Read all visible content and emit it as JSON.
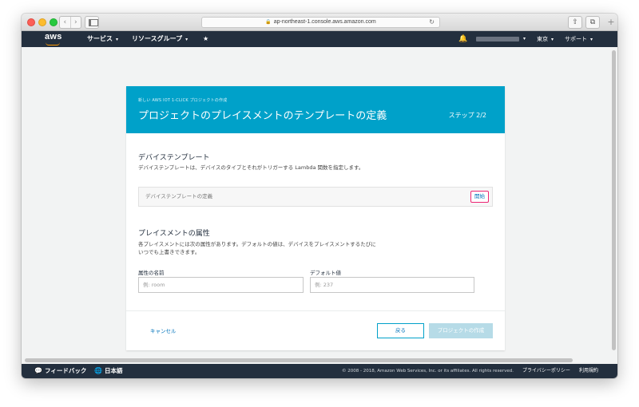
{
  "browser": {
    "address": "ap-northeast-1.console.aws.amazon.com",
    "lock_icon": "🔒",
    "reload_icon": "↻",
    "back_icon": "‹",
    "forward_icon": "›",
    "share_icon": "⇧",
    "tabs_icon": "⧉",
    "newtab_icon": "+"
  },
  "aws_nav": {
    "logo": "aws",
    "services": "サービス",
    "resource_groups": "リソースグループ",
    "caret": "▾",
    "pin_icon": "★",
    "bell_icon": "🔔",
    "region": "東京",
    "support": "サポート"
  },
  "header": {
    "breadcrumb": "新しい AWS IOT 1-CLICK プロジェクトの作成",
    "title": "プロジェクトのプレイスメントのテンプレートの定義",
    "step": "ステップ 2/2"
  },
  "device_template": {
    "title": "デバイステンプレート",
    "description": "デバイステンプレートは、デバイスのタイプとそれがトリガーする Lambda 関数を指定します。",
    "box_label": "デバイステンプレートの定義",
    "start_button": "開始"
  },
  "placement": {
    "title": "プレイスメントの属性",
    "description": "各プレイスメントには次の属性があります。デフォルトの値は、デバイスをプレイスメントするたびにいつでも上書きできます。",
    "attr_name_label": "属性の名前",
    "attr_name_placeholder": "例: room",
    "default_value_label": "デフォルト値",
    "default_value_placeholder": "例: 237"
  },
  "actions": {
    "cancel": "キャンセル",
    "back": "戻る",
    "create": "プロジェクトの作成"
  },
  "footer": {
    "feedback_icon": "💬",
    "feedback": "フィードバック",
    "globe_icon": "🌐",
    "language": "日本語",
    "copyright": "© 2008 - 2018, Amazon Web Services, Inc. or its affiliates. All rights reserved.",
    "privacy": "プライバシーポリシー",
    "terms": "利用規約"
  }
}
